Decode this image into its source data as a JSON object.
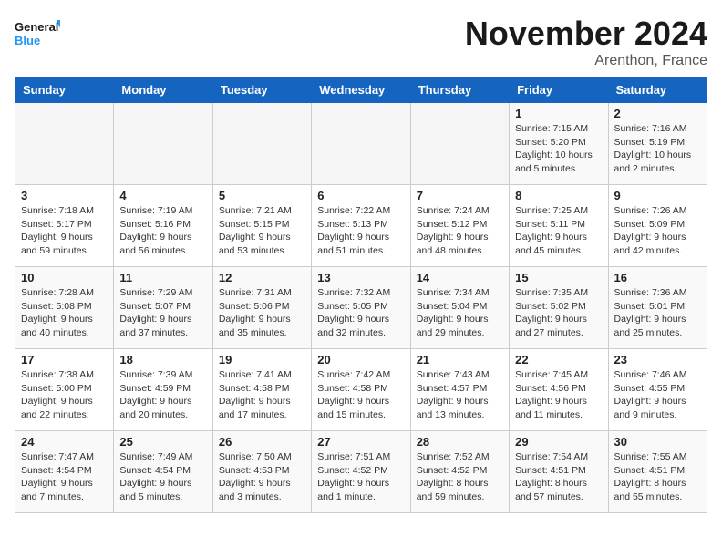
{
  "logo": {
    "line1": "General",
    "line2": "Blue"
  },
  "title": "November 2024",
  "location": "Arenthon, France",
  "days_header": [
    "Sunday",
    "Monday",
    "Tuesday",
    "Wednesday",
    "Thursday",
    "Friday",
    "Saturday"
  ],
  "weeks": [
    [
      {
        "day": "",
        "info": ""
      },
      {
        "day": "",
        "info": ""
      },
      {
        "day": "",
        "info": ""
      },
      {
        "day": "",
        "info": ""
      },
      {
        "day": "",
        "info": ""
      },
      {
        "day": "1",
        "info": "Sunrise: 7:15 AM\nSunset: 5:20 PM\nDaylight: 10 hours\nand 5 minutes."
      },
      {
        "day": "2",
        "info": "Sunrise: 7:16 AM\nSunset: 5:19 PM\nDaylight: 10 hours\nand 2 minutes."
      }
    ],
    [
      {
        "day": "3",
        "info": "Sunrise: 7:18 AM\nSunset: 5:17 PM\nDaylight: 9 hours\nand 59 minutes."
      },
      {
        "day": "4",
        "info": "Sunrise: 7:19 AM\nSunset: 5:16 PM\nDaylight: 9 hours\nand 56 minutes."
      },
      {
        "day": "5",
        "info": "Sunrise: 7:21 AM\nSunset: 5:15 PM\nDaylight: 9 hours\nand 53 minutes."
      },
      {
        "day": "6",
        "info": "Sunrise: 7:22 AM\nSunset: 5:13 PM\nDaylight: 9 hours\nand 51 minutes."
      },
      {
        "day": "7",
        "info": "Sunrise: 7:24 AM\nSunset: 5:12 PM\nDaylight: 9 hours\nand 48 minutes."
      },
      {
        "day": "8",
        "info": "Sunrise: 7:25 AM\nSunset: 5:11 PM\nDaylight: 9 hours\nand 45 minutes."
      },
      {
        "day": "9",
        "info": "Sunrise: 7:26 AM\nSunset: 5:09 PM\nDaylight: 9 hours\nand 42 minutes."
      }
    ],
    [
      {
        "day": "10",
        "info": "Sunrise: 7:28 AM\nSunset: 5:08 PM\nDaylight: 9 hours\nand 40 minutes."
      },
      {
        "day": "11",
        "info": "Sunrise: 7:29 AM\nSunset: 5:07 PM\nDaylight: 9 hours\nand 37 minutes."
      },
      {
        "day": "12",
        "info": "Sunrise: 7:31 AM\nSunset: 5:06 PM\nDaylight: 9 hours\nand 35 minutes."
      },
      {
        "day": "13",
        "info": "Sunrise: 7:32 AM\nSunset: 5:05 PM\nDaylight: 9 hours\nand 32 minutes."
      },
      {
        "day": "14",
        "info": "Sunrise: 7:34 AM\nSunset: 5:04 PM\nDaylight: 9 hours\nand 29 minutes."
      },
      {
        "day": "15",
        "info": "Sunrise: 7:35 AM\nSunset: 5:02 PM\nDaylight: 9 hours\nand 27 minutes."
      },
      {
        "day": "16",
        "info": "Sunrise: 7:36 AM\nSunset: 5:01 PM\nDaylight: 9 hours\nand 25 minutes."
      }
    ],
    [
      {
        "day": "17",
        "info": "Sunrise: 7:38 AM\nSunset: 5:00 PM\nDaylight: 9 hours\nand 22 minutes."
      },
      {
        "day": "18",
        "info": "Sunrise: 7:39 AM\nSunset: 4:59 PM\nDaylight: 9 hours\nand 20 minutes."
      },
      {
        "day": "19",
        "info": "Sunrise: 7:41 AM\nSunset: 4:58 PM\nDaylight: 9 hours\nand 17 minutes."
      },
      {
        "day": "20",
        "info": "Sunrise: 7:42 AM\nSunset: 4:58 PM\nDaylight: 9 hours\nand 15 minutes."
      },
      {
        "day": "21",
        "info": "Sunrise: 7:43 AM\nSunset: 4:57 PM\nDaylight: 9 hours\nand 13 minutes."
      },
      {
        "day": "22",
        "info": "Sunrise: 7:45 AM\nSunset: 4:56 PM\nDaylight: 9 hours\nand 11 minutes."
      },
      {
        "day": "23",
        "info": "Sunrise: 7:46 AM\nSunset: 4:55 PM\nDaylight: 9 hours\nand 9 minutes."
      }
    ],
    [
      {
        "day": "24",
        "info": "Sunrise: 7:47 AM\nSunset: 4:54 PM\nDaylight: 9 hours\nand 7 minutes."
      },
      {
        "day": "25",
        "info": "Sunrise: 7:49 AM\nSunset: 4:54 PM\nDaylight: 9 hours\nand 5 minutes."
      },
      {
        "day": "26",
        "info": "Sunrise: 7:50 AM\nSunset: 4:53 PM\nDaylight: 9 hours\nand 3 minutes."
      },
      {
        "day": "27",
        "info": "Sunrise: 7:51 AM\nSunset: 4:52 PM\nDaylight: 9 hours\nand 1 minute."
      },
      {
        "day": "28",
        "info": "Sunrise: 7:52 AM\nSunset: 4:52 PM\nDaylight: 8 hours\nand 59 minutes."
      },
      {
        "day": "29",
        "info": "Sunrise: 7:54 AM\nSunset: 4:51 PM\nDaylight: 8 hours\nand 57 minutes."
      },
      {
        "day": "30",
        "info": "Sunrise: 7:55 AM\nSunset: 4:51 PM\nDaylight: 8 hours\nand 55 minutes."
      }
    ]
  ]
}
